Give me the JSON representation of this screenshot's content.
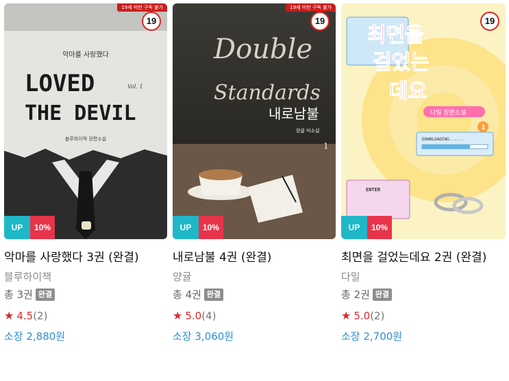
{
  "books": [
    {
      "title": "악마를 사랑했다 3권 (완결)",
      "author": "블루하이잭",
      "volumes": "총 3권",
      "complete_badge": "완결",
      "rating": "4.5",
      "rating_count": "(2)",
      "price": "소장 2,880원",
      "age": "19",
      "age_notice": "19세 미만 구독 불가",
      "promo_up": "UP",
      "promo_discount": "10%",
      "cover": {
        "subtitle": "악마를 사랑했다",
        "title_line1": "LOVED",
        "title_line2": "THE DEVIL",
        "vol": "Vol. 1",
        "author_line": "블루하이잭 장편소설"
      }
    },
    {
      "title": "내로남불 4권 (완결)",
      "author": "양귤",
      "volumes": "총 4권",
      "complete_badge": "완결",
      "rating": "5.0",
      "rating_count": "(4)",
      "price": "소장 3,060원",
      "age": "19",
      "age_notice": "19세 미만 구독 불가",
      "promo_up": "UP",
      "promo_discount": "10%",
      "cover": {
        "script_line1": "Double",
        "script_line2": "Standards",
        "korean_title": "내로남불",
        "author_line": "양귤 미소설",
        "vol": "1"
      }
    },
    {
      "title": "최면을 걸었는데요 2권 (완결)",
      "author": "다밀",
      "volumes": "총 2권",
      "complete_badge": "완결",
      "rating": "5.0",
      "rating_count": "(2)",
      "price": "소장 2,700원",
      "age": "19",
      "age_notice": "",
      "promo_up": "UP",
      "promo_discount": "10%",
      "cover": {
        "title_line1": "최면을",
        "title_line2": "걸었는",
        "title_line3": "데요",
        "author_line": "다밀 장편소설",
        "vol": "1",
        "downloading": "DOWNLOADING......",
        "enter": "ENTER"
      }
    }
  ],
  "colors": {
    "age_red": "#e02424",
    "up_teal": "#1fb8c9",
    "discount_pink": "#e8344a",
    "star_red": "#e0272b",
    "price_blue": "#2c8fd4"
  }
}
